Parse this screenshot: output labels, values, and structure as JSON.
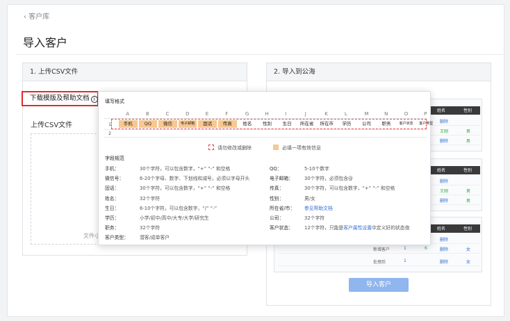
{
  "header": {
    "back": "客户库",
    "title": "导入客户"
  },
  "panel1": {
    "title": "1. 上传CSV文件",
    "download_link": "下载模版及帮助文档",
    "info_icon": "i",
    "upload_label": "上传CSV文件",
    "file_hint": "文件小"
  },
  "panel2": {
    "title": "2. 导入到公海",
    "import_button": "导入客户"
  },
  "mini_tables": {
    "head": [
      "姓名",
      "性别"
    ],
    "t1": [
      [
        "删除",
        ""
      ],
      [
        "王刚",
        "男"
      ],
      [
        "删除",
        "男"
      ]
    ],
    "t2": [
      [
        "删除",
        ""
      ],
      [
        "王刚",
        "男"
      ],
      [
        "删除",
        "男"
      ]
    ],
    "t3": [
      [
        "删除",
        ""
      ],
      [
        "删除",
        "女"
      ]
    ],
    "t3_rows": [
      {
        "label": "新增客户",
        "a": "1",
        "b": "6",
        "c": "删除",
        "d": "女"
      },
      {
        "label": "处理后",
        "a": "1",
        "b": "",
        "c": "删除",
        "d": "女"
      }
    ]
  },
  "popover": {
    "title": "填写格式",
    "columns": [
      "A",
      "B",
      "C",
      "D",
      "E",
      "F",
      "G",
      "H",
      "I",
      "J",
      "K",
      "L",
      "M",
      "N",
      "O",
      "P"
    ],
    "row_numbers": [
      "1",
      "2"
    ],
    "headers": [
      "手机",
      "QQ",
      "微信",
      "电子邮箱",
      "固话",
      "传真",
      "姓名",
      "性别",
      "生日",
      "所在省",
      "所在市",
      "学历",
      "公司",
      "职务",
      "客户状态",
      "客户类型"
    ],
    "legend_red": "请勿修改或删除",
    "legend_orange": "必填一项有效信息",
    "rules_title": "字段规范",
    "rules_left": [
      {
        "k": "手机：",
        "v": "30个字符，可以包含数字，“+”  “-” 和空格"
      },
      {
        "k": "微信号：",
        "v": "6-20个字母、数字、下划线和减号，必须以字母开头"
      },
      {
        "k": "固话：",
        "v": "30个字符，可以包含数字，“+”  “-” 和空格"
      },
      {
        "k": "姓名：",
        "v": "32个字符"
      },
      {
        "k": "生日：",
        "v": "6-10个字符，可以包含数字，“/”  “-”"
      },
      {
        "k": "学历：",
        "v": "小学/初中/高中/大专/大学/研究生"
      },
      {
        "k": "职务：",
        "v": "32个字符"
      },
      {
        "k": "客户类型：",
        "v": "潜客/成单客户"
      }
    ],
    "rules_right": [
      {
        "k": "QQ：",
        "v": "5-10个数字"
      },
      {
        "k": "电子邮箱：",
        "v": "30个字符，必须包含@"
      },
      {
        "k": "传真：",
        "v": "30个字符，可以包含数字，“+”  “-” 和空格"
      },
      {
        "k": "性别：",
        "v": "男/女"
      },
      {
        "k": "所在省/市：",
        "v": "参见帮助文档",
        "link": true
      },
      {
        "k": "公司：",
        "v": "32个字符"
      },
      {
        "k": "客户状态：",
        "v_pre": "12个字符，只能是",
        "v_link": "客户属性设置",
        "v_post": "中定义好的状态值"
      }
    ]
  },
  "colors": {
    "accent_blue": "#2f6fd6",
    "button_bg": "#8fb6ee",
    "highlight_red": "#e02b2b",
    "required_orange": "#f7c891"
  }
}
